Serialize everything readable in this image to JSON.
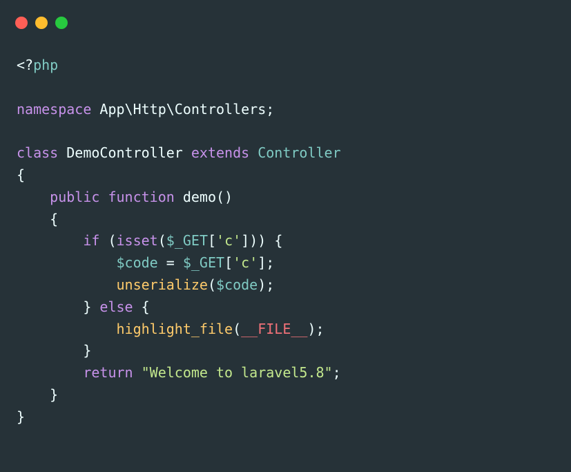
{
  "window": {
    "controls": [
      {
        "name": "close",
        "color": "#FF5F56"
      },
      {
        "name": "minimize",
        "color": "#FFBD2E"
      },
      {
        "name": "maximize",
        "color": "#27C93F"
      }
    ]
  },
  "theme": {
    "background": "#263238",
    "keyword": "#C792EA",
    "function": "#FFCB6B",
    "variable": "#80CBC4",
    "string": "#C3E88D",
    "constant": "#F07178",
    "text": "#EEFFFF"
  },
  "code": {
    "lines": [
      [
        {
          "t": "<?",
          "c": "plain"
        },
        {
          "t": "php",
          "c": "var"
        }
      ],
      [],
      [
        {
          "t": "namespace",
          "c": "kw"
        },
        {
          "t": " App\\Http\\Controllers;",
          "c": "plain"
        }
      ],
      [],
      [
        {
          "t": "class",
          "c": "kw"
        },
        {
          "t": " DemoController ",
          "c": "plain"
        },
        {
          "t": "extends",
          "c": "kw"
        },
        {
          "t": " ",
          "c": "plain"
        },
        {
          "t": "Controller",
          "c": "var"
        }
      ],
      [
        {
          "t": "{",
          "c": "plain"
        }
      ],
      [
        {
          "t": "    ",
          "c": "plain"
        },
        {
          "t": "public",
          "c": "kw"
        },
        {
          "t": " ",
          "c": "plain"
        },
        {
          "t": "function",
          "c": "kw"
        },
        {
          "t": " demo()",
          "c": "plain"
        }
      ],
      [
        {
          "t": "    {",
          "c": "plain"
        }
      ],
      [
        {
          "t": "        ",
          "c": "plain"
        },
        {
          "t": "if",
          "c": "kw"
        },
        {
          "t": " (",
          "c": "plain"
        },
        {
          "t": "isset",
          "c": "kw"
        },
        {
          "t": "(",
          "c": "plain"
        },
        {
          "t": "$_GET",
          "c": "var"
        },
        {
          "t": "[",
          "c": "plain"
        },
        {
          "t": "'c'",
          "c": "str"
        },
        {
          "t": "])) {",
          "c": "plain"
        }
      ],
      [
        {
          "t": "            ",
          "c": "plain"
        },
        {
          "t": "$code",
          "c": "var"
        },
        {
          "t": " = ",
          "c": "plain"
        },
        {
          "t": "$_GET",
          "c": "var"
        },
        {
          "t": "[",
          "c": "plain"
        },
        {
          "t": "'c'",
          "c": "str"
        },
        {
          "t": "];",
          "c": "plain"
        }
      ],
      [
        {
          "t": "            ",
          "c": "plain"
        },
        {
          "t": "unserialize",
          "c": "fn"
        },
        {
          "t": "(",
          "c": "plain"
        },
        {
          "t": "$code",
          "c": "var"
        },
        {
          "t": ");",
          "c": "plain"
        }
      ],
      [
        {
          "t": "        } ",
          "c": "plain"
        },
        {
          "t": "else",
          "c": "kw"
        },
        {
          "t": " {",
          "c": "plain"
        }
      ],
      [
        {
          "t": "            ",
          "c": "plain"
        },
        {
          "t": "highlight_file",
          "c": "fn"
        },
        {
          "t": "(",
          "c": "plain"
        },
        {
          "t": "__FILE__",
          "c": "const"
        },
        {
          "t": ");",
          "c": "plain"
        }
      ],
      [
        {
          "t": "        }",
          "c": "plain"
        }
      ],
      [
        {
          "t": "        ",
          "c": "plain"
        },
        {
          "t": "return",
          "c": "kw"
        },
        {
          "t": " ",
          "c": "plain"
        },
        {
          "t": "\"Welcome to laravel5.8\"",
          "c": "str"
        },
        {
          "t": ";",
          "c": "plain"
        }
      ],
      [
        {
          "t": "    }",
          "c": "plain"
        }
      ],
      [
        {
          "t": "}",
          "c": "plain"
        }
      ]
    ]
  }
}
